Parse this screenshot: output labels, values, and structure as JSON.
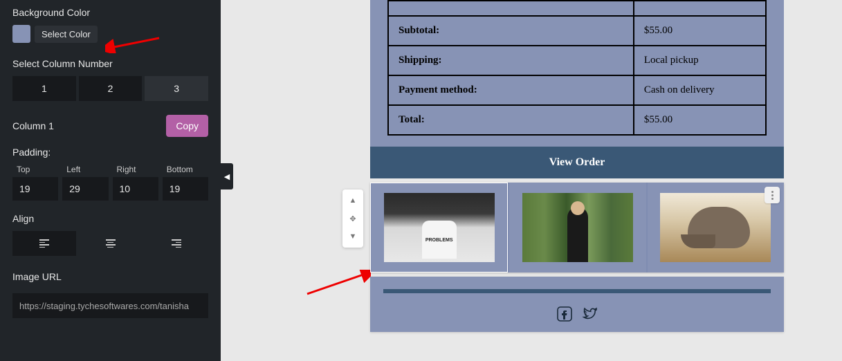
{
  "sidebar": {
    "bg_label": "Background Color",
    "select_color": "Select Color",
    "swatch_color": "#8793b5",
    "col_num_label": "Select Column Number",
    "col_options": [
      "1",
      "2",
      "3"
    ],
    "col_active": "3",
    "column_title": "Column 1",
    "copy": "Copy",
    "padding_label": "Padding:",
    "padding": {
      "top": {
        "label": "Top",
        "value": "19"
      },
      "left": {
        "label": "Left",
        "value": "29"
      },
      "right": {
        "label": "Right",
        "value": "10"
      },
      "bottom": {
        "label": "Bottom",
        "value": "19"
      }
    },
    "align_label": "Align",
    "image_url_label": "Image URL",
    "image_url_value": "https://staging.tychesoftwares.com/tanisha"
  },
  "order": {
    "rows": [
      {
        "label": "Subtotal:",
        "value": "$55.00"
      },
      {
        "label": "Shipping:",
        "value": "Local pickup"
      },
      {
        "label": "Payment method:",
        "value": "Cash on delivery"
      },
      {
        "label": "Total:",
        "value": "$55.00"
      }
    ],
    "view_order": "View Order"
  },
  "icons": {
    "facebook": "facebook",
    "twitter": "twitter"
  }
}
